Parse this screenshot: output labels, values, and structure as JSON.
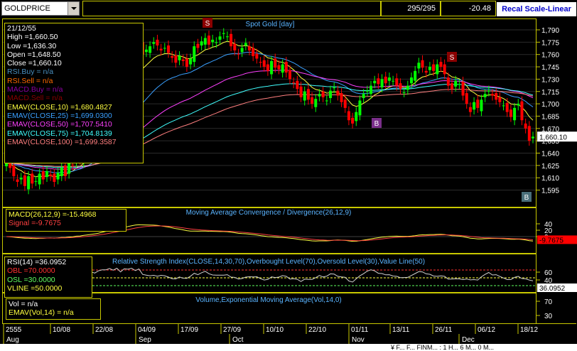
{
  "toolbar": {
    "symbol": "GOLDPRICE",
    "bar_count": "295/295",
    "change": "-20.48",
    "recal_label": "Recal Scale-Linear"
  },
  "price_panel": {
    "title": "Spot Gold [day]",
    "last_price_label": "1,660.10",
    "y_ticks": [
      "1,790",
      "1,775",
      "1,760",
      "1,745",
      "1,730",
      "1,715",
      "1,700",
      "1,685",
      "1,670",
      "1,655",
      "1,640",
      "1,625",
      "1,610",
      "1,595"
    ],
    "markers": [
      {
        "label": "S",
        "color": "#8b0000"
      },
      {
        "label": "S",
        "color": "#8b0000"
      },
      {
        "label": "B",
        "color": "#7a2f8a"
      },
      {
        "label": "B",
        "color": "#4a6f7a"
      }
    ],
    "info": [
      {
        "text": "21/12/55",
        "color": "#ffffff"
      },
      {
        "text": "High  =1,660.50",
        "color": "#ffffff"
      },
      {
        "text": "Low   =1,636.30",
        "color": "#ffffff"
      },
      {
        "text": "Open  =1,648.50",
        "color": "#ffffff"
      },
      {
        "text": "Close =1,660.10",
        "color": "#ffffff"
      },
      {
        "text": "RSI.Buy    = n/a",
        "color": "#4a90c0"
      },
      {
        "text": "RSI.Sell   = n/a",
        "color": "#ff6a00"
      },
      {
        "text": "MACD.Buy   = n/a",
        "color": "#8a00a0"
      },
      {
        "text": "MACD.Sell  = n/a",
        "color": "#8b0000"
      },
      {
        "text": "EMAV(CLOSE,10)  =1,680.4827",
        "color": "#ffff40"
      },
      {
        "text": "EMAV(CLOSE,25)  =1,699.0300",
        "color": "#3aa0ff"
      },
      {
        "text": "EMAV(CLOSE,50)  =1,707.5410",
        "color": "#ff40ff"
      },
      {
        "text": "EMAV(CLOSE,75)  =1,704.8139",
        "color": "#40ffff"
      },
      {
        "text": "EMAV(CLOSE,100) =1,699.3587",
        "color": "#ff7f7f"
      }
    ]
  },
  "macd_panel": {
    "title": "Moving Average Convergence / Divergence(26,12,9)",
    "y_ticks": [
      "40",
      "20",
      "0"
    ],
    "last_label": "-9.7675",
    "info": [
      {
        "text": "MACD(26,12,9)  =-15.4968",
        "color": "#ffff40"
      },
      {
        "text": "Signal  =-9.7675",
        "color": "#ff4040"
      }
    ]
  },
  "rsi_panel": {
    "title": "Relative Strength Index(CLOSE,14,30,70),Overbought Level(70),Oversold Level(30),Value Line(50)",
    "y_ticks": [
      "60",
      "40"
    ],
    "last_label": "36.0952",
    "info": [
      {
        "text": "RSI(14)   =36.0952",
        "color": "#ffffff"
      },
      {
        "text": "OBL   =70.0000",
        "color": "#ff3030"
      },
      {
        "text": "OSL   =30.0000",
        "color": "#60ff60"
      },
      {
        "text": "VLINE  =50.0000",
        "color": "#ffff40"
      }
    ]
  },
  "volume_panel": {
    "title": "Volume,Exponential Moving Average(Vol,14,0)",
    "y_ticks": [
      "70",
      "30"
    ],
    "info": [
      {
        "text": "Vol   = n/a",
        "color": "#ffffff"
      },
      {
        "text": "EMAV(Vol,14)   = n/a",
        "color": "#ffff40"
      }
    ]
  },
  "date_axis": {
    "dates": [
      "2555",
      "10/08",
      "22/08",
      "04/09",
      "17/09",
      "27/09",
      "10/10",
      "22/10",
      "01/11",
      "13/11",
      "26/11",
      "06/12",
      "18/12"
    ],
    "months": [
      "Aug",
      "Sep",
      "Oct",
      "Nov",
      "Dec"
    ]
  },
  "status_bar": {
    "text": "¥ F... F... FINM... : 1 H... 6 M... 0 M..."
  }
}
